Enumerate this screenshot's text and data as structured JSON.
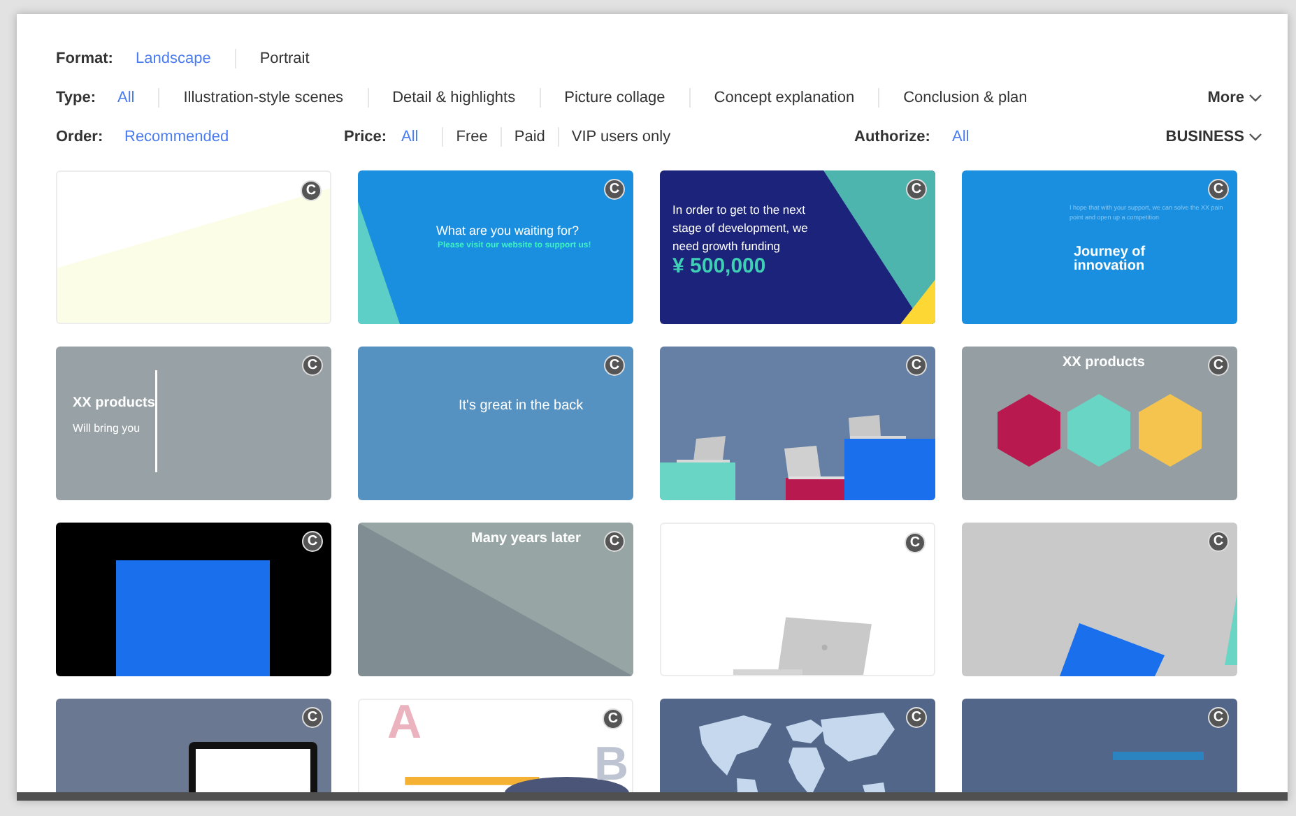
{
  "filters": {
    "format": {
      "label": "Format:",
      "options": [
        {
          "text": "Landscape",
          "selected": true
        },
        {
          "text": "Portrait",
          "selected": false
        }
      ]
    },
    "type": {
      "label": "Type:",
      "options": [
        {
          "text": "All",
          "selected": true
        },
        {
          "text": "Illustration-style scenes",
          "selected": false
        },
        {
          "text": "Detail & highlights",
          "selected": false
        },
        {
          "text": "Picture collage",
          "selected": false
        },
        {
          "text": "Concept explanation",
          "selected": false
        },
        {
          "text": "Conclusion & plan",
          "selected": false
        }
      ],
      "more": "More"
    },
    "order": {
      "label": "Order:",
      "options": [
        {
          "text": "Recommended",
          "selected": true
        }
      ]
    },
    "price": {
      "label": "Price:",
      "options": [
        {
          "text": "All",
          "selected": true
        },
        {
          "text": "Free",
          "selected": false
        },
        {
          "text": "Paid",
          "selected": false
        },
        {
          "text": "VIP users only",
          "selected": false
        }
      ]
    },
    "authorize": {
      "label": "Authorize:",
      "options": [
        {
          "text": "All",
          "selected": true
        }
      ]
    },
    "license": {
      "text": "BUSINESS"
    }
  },
  "cards": [
    {
      "kind": "yellow-wedge",
      "badge": "C"
    },
    {
      "kind": "blue-teal",
      "badge": "C",
      "title": "What are you waiting for?",
      "subtitle": "Please visit our website to support us!"
    },
    {
      "kind": "navy-funding",
      "badge": "C",
      "text": "In order to get to the next stage of development, we need growth funding",
      "amount": "¥ 500,000"
    },
    {
      "kind": "blue-journey",
      "badge": "C",
      "note": "I hope that with your support, we can solve the XX pain point and open up a competition",
      "title": "Journey of innovation"
    },
    {
      "kind": "grey-products",
      "badge": "C",
      "title": "XX products",
      "subtitle": "Will bring you"
    },
    {
      "kind": "blue-text",
      "badge": "C",
      "title": "It's great in the back"
    },
    {
      "kind": "laptops",
      "badge": "C"
    },
    {
      "kind": "hexagons",
      "badge": "C",
      "title": "XX products"
    },
    {
      "kind": "black-blue",
      "badge": "C"
    },
    {
      "kind": "grey-diagonal",
      "badge": "C",
      "title": "Many years later"
    },
    {
      "kind": "white-laptop",
      "badge": "C"
    },
    {
      "kind": "grey-tilted",
      "badge": "C"
    },
    {
      "kind": "slate-monitor",
      "badge": "C"
    },
    {
      "kind": "letters",
      "badge": "C",
      "letter_a": "A",
      "letter_b": "B"
    },
    {
      "kind": "world-map",
      "badge": "C"
    },
    {
      "kind": "navy-bar",
      "badge": "C"
    }
  ]
}
